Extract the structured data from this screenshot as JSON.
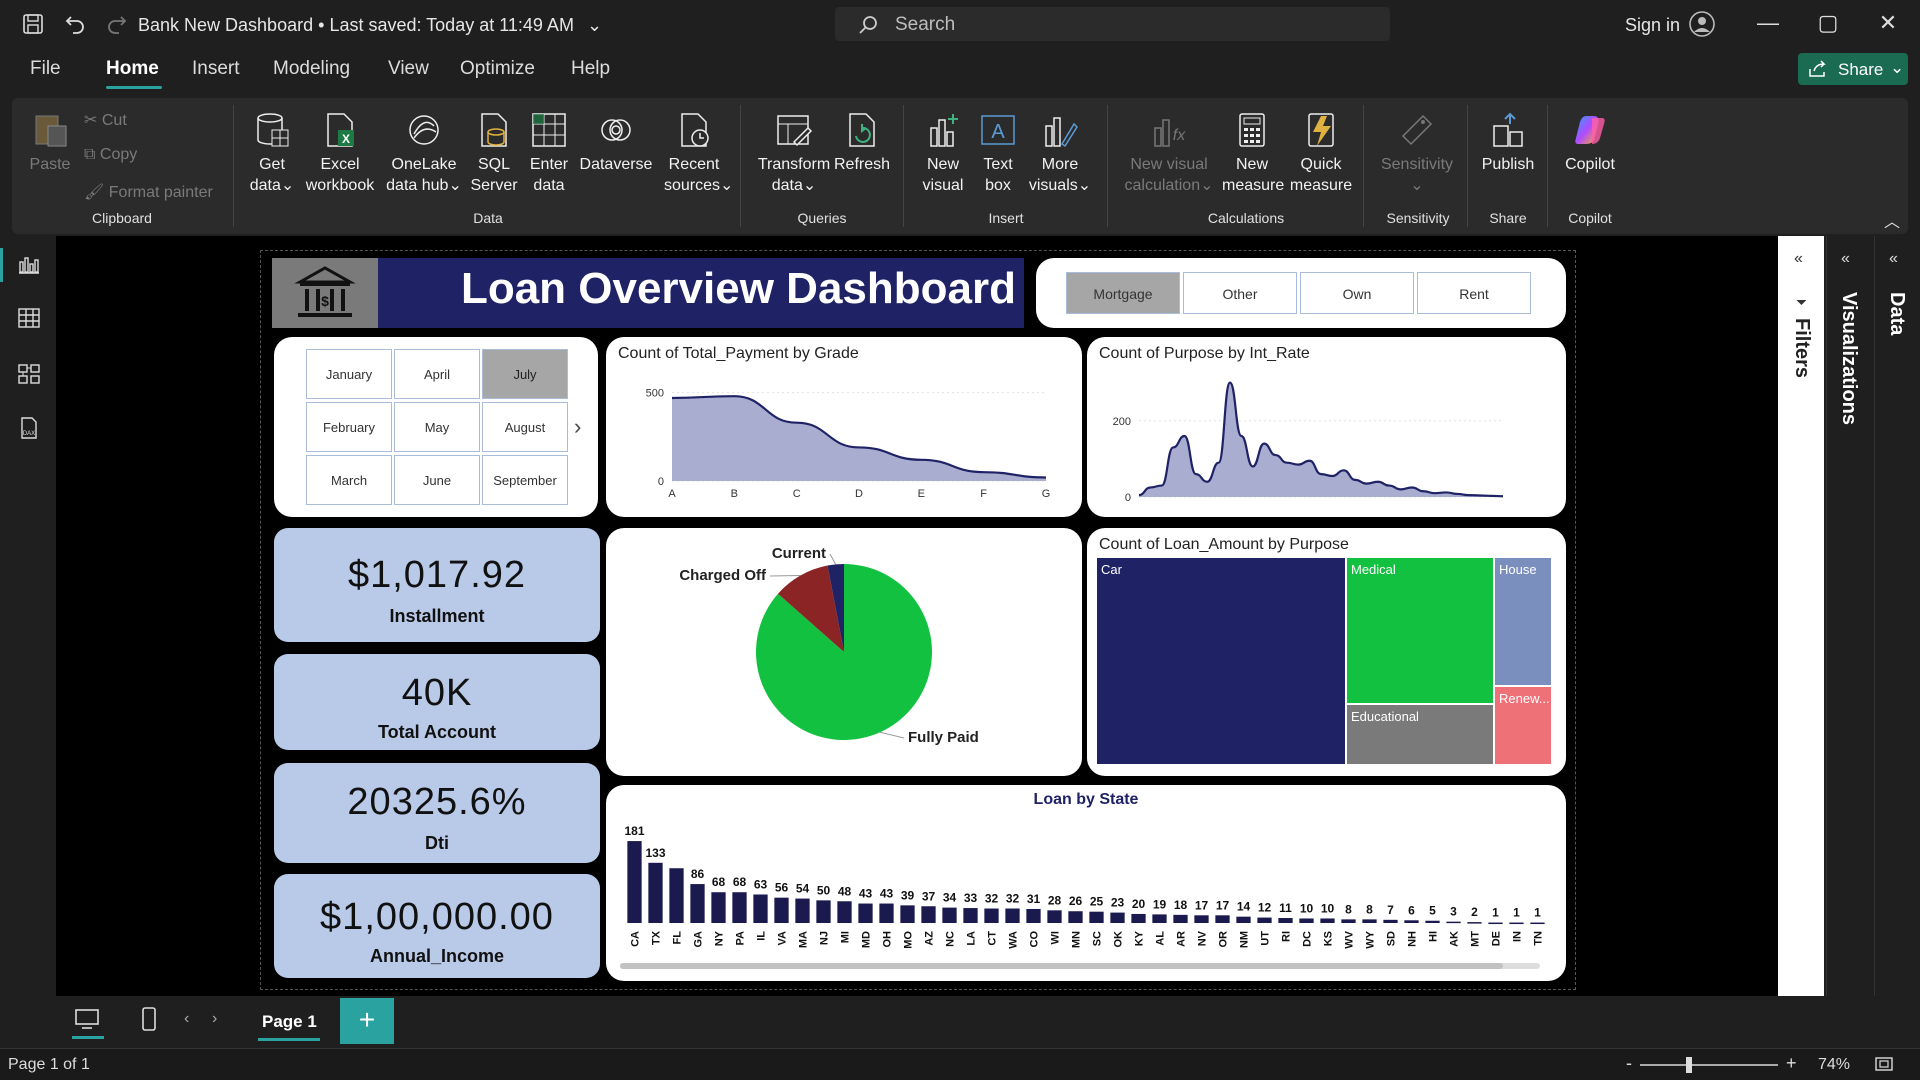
{
  "titlebar": {
    "doc_title": "Bank New Dashboard",
    "saved_status": "Last saved: Today at 11:49 AM",
    "search_placeholder": "Search",
    "signin": "Sign in"
  },
  "menu": {
    "items": [
      "File",
      "Home",
      "Insert",
      "Modeling",
      "View",
      "Optimize",
      "Help"
    ],
    "active": "Home",
    "share_label": "Share"
  },
  "ribbon": {
    "clipboard": {
      "paste": "Paste",
      "cut": "Cut",
      "copy": "Copy",
      "format_painter": "Format painter",
      "group": "Clipboard"
    },
    "data": {
      "get_data": [
        "Get",
        "data"
      ],
      "excel": [
        "Excel",
        "workbook"
      ],
      "onelake": [
        "OneLake",
        "data hub"
      ],
      "sql": [
        "SQL",
        "Server"
      ],
      "enter_data": [
        "Enter",
        "data"
      ],
      "dataverse": [
        "Dataverse",
        ""
      ],
      "recent": [
        "Recent",
        "sources"
      ],
      "group": "Data"
    },
    "queries": {
      "transform": [
        "Transform",
        "data"
      ],
      "refresh": [
        "Refresh",
        ""
      ],
      "group": "Queries"
    },
    "insert": {
      "new_visual": [
        "New",
        "visual"
      ],
      "text_box": [
        "Text",
        "box"
      ],
      "more_visuals": [
        "More",
        "visuals"
      ],
      "group": "Insert"
    },
    "calculations": {
      "new_visual_calc": [
        "New visual",
        "calculation"
      ],
      "new_measure": [
        "New",
        "measure"
      ],
      "quick_measure": [
        "Quick",
        "measure"
      ],
      "group": "Calculations"
    },
    "sensitivity": {
      "label": "Sensitivity",
      "group": "Sensitivity"
    },
    "share": {
      "publish": "Publish",
      "group": "Share"
    },
    "copilot": {
      "label": "Copilot",
      "group": "Copilot"
    }
  },
  "report": {
    "title": "Loan Overview Dashboard",
    "ownership_slicer": {
      "options": [
        "Mortgage",
        "Other",
        "Own",
        "Rent"
      ],
      "selected": "Mortgage"
    },
    "month_slicer": {
      "rows": [
        [
          "January",
          "April",
          "July"
        ],
        [
          "February",
          "May",
          "August"
        ],
        [
          "March",
          "June",
          "September"
        ]
      ],
      "selected": "July"
    },
    "kpis": [
      {
        "value": "$1,017.92",
        "label": "Installment"
      },
      {
        "value": "40K",
        "label": "Total Account"
      },
      {
        "value": "20325.6%",
        "label": "Dti"
      },
      {
        "value": "$1,00,000.00",
        "label": "Annual_Income"
      }
    ]
  },
  "chart_data": [
    {
      "type": "area",
      "title": "Count of Total_Payment by Grade",
      "categories": [
        "A",
        "B",
        "C",
        "D",
        "E",
        "F",
        "G"
      ],
      "values": [
        470,
        480,
        330,
        190,
        120,
        50,
        20
      ],
      "yticks": [
        0,
        500
      ],
      "ylim": [
        0,
        600
      ],
      "color": "#a9aed0",
      "line_color": "#1f2366"
    },
    {
      "type": "area",
      "title": "Count of Purpose by Int_Rate",
      "x": [
        0,
        1,
        2,
        3,
        4,
        5,
        6,
        7,
        8,
        9,
        10,
        11,
        12,
        13,
        14,
        15,
        16,
        17,
        18,
        19,
        20,
        21,
        22,
        23,
        24,
        25,
        26,
        27,
        28,
        29,
        30,
        31,
        32
      ],
      "values": [
        5,
        25,
        30,
        130,
        160,
        60,
        40,
        90,
        300,
        160,
        80,
        140,
        110,
        90,
        85,
        95,
        60,
        55,
        70,
        45,
        35,
        40,
        30,
        20,
        25,
        15,
        10,
        12,
        8,
        5,
        4,
        3,
        2
      ],
      "yticks": [
        0,
        200
      ],
      "ylim": [
        0,
        320
      ],
      "color": "#a9aed0",
      "line_color": "#1f2366"
    },
    {
      "type": "pie",
      "slices": [
        {
          "label": "Fully Paid",
          "value": 86.5,
          "color": "#12c140"
        },
        {
          "label": "Charged Off",
          "value": 10.5,
          "color": "#8b2525"
        },
        {
          "label": "Current",
          "value": 3.0,
          "color": "#1f2366"
        }
      ]
    },
    {
      "type": "treemap",
      "title": "Count of Loan_Amount by Purpose",
      "items": [
        {
          "label": "Car",
          "color": "#1f2366"
        },
        {
          "label": "Medical",
          "color": "#12c140"
        },
        {
          "label": "House",
          "color": "#7b8fbe"
        },
        {
          "label": "Educational",
          "color": "#7a7a7a"
        },
        {
          "label": "Renew...",
          "color": "#ef7178"
        }
      ]
    },
    {
      "type": "bar",
      "title": "Loan by State",
      "categories": [
        "CA",
        "TX",
        "FL",
        "GA",
        "NY",
        "PA",
        "IL",
        "VA",
        "MA",
        "NJ",
        "MI",
        "MD",
        "OH",
        "MO",
        "AZ",
        "NC",
        "LA",
        "CT",
        "WA",
        "CO",
        "WI",
        "MN",
        "SC",
        "OK",
        "KY",
        "AL",
        "AR",
        "NV",
        "OR",
        "NM",
        "UT",
        "RI",
        "DC",
        "KS",
        "WV",
        "WY",
        "SD",
        "NH",
        "HI",
        "AK",
        "MT",
        "DE",
        "IN",
        "TN"
      ],
      "values": [
        181,
        133,
        121,
        86,
        68,
        68,
        63,
        56,
        54,
        50,
        48,
        43,
        43,
        39,
        37,
        34,
        33,
        32,
        32,
        31,
        28,
        26,
        25,
        23,
        20,
        19,
        18,
        17,
        17,
        14,
        12,
        11,
        10,
        10,
        8,
        8,
        7,
        6,
        5,
        3,
        2,
        1,
        1,
        1
      ],
      "labels": [
        "181",
        "133",
        "",
        "86",
        "68",
        "68",
        "63",
        "56",
        "54",
        "50",
        "48",
        "43",
        "43",
        "39",
        "37",
        "34",
        "33",
        "32",
        "32",
        "31",
        "28",
        "26",
        "25",
        "23",
        "20",
        "19",
        "18",
        "17",
        "17",
        "14",
        "12",
        "11",
        "10",
        "10",
        "8",
        "8",
        "7",
        "6",
        "5",
        "3",
        "2",
        "1",
        "1",
        "1"
      ],
      "ylim": [
        0,
        190
      ],
      "color": "#1a1a4e"
    }
  ],
  "panes": {
    "filters": "Filters",
    "visualizations": "Visualizations",
    "data": "Data"
  },
  "pagebar": {
    "page_tab": "Page 1"
  },
  "status": {
    "page_info": "Page 1 of 1",
    "zoom": "74%"
  }
}
